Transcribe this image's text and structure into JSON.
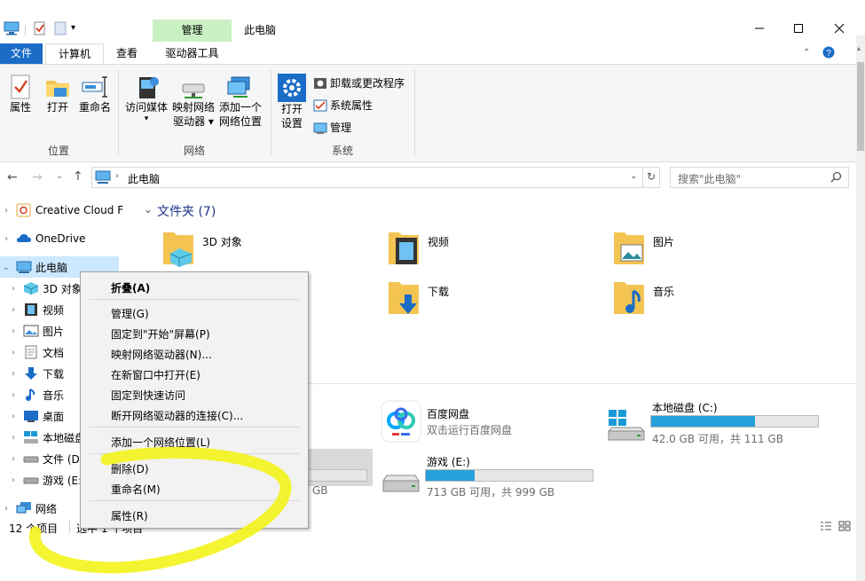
{
  "window": {
    "title": "此电脑",
    "context_tab_group": "管理"
  },
  "ribbon_tabs": [
    "文件",
    "计算机",
    "查看",
    "驱动器工具"
  ],
  "ribbon": {
    "location": {
      "label": "位置",
      "buttons": [
        "属性",
        "打开",
        "重命名"
      ]
    },
    "network": {
      "label": "网络",
      "buttons": [
        [
          "访问媒体",
          ""
        ],
        [
          "映射网络",
          "驱动器"
        ],
        [
          "添加一个",
          "网络位置"
        ]
      ]
    },
    "system": {
      "label": "系统",
      "open_settings": [
        "打开",
        "设置"
      ],
      "small_items": [
        "卸载或更改程序",
        "系统属性",
        "管理"
      ]
    }
  },
  "address": {
    "path": "此电脑",
    "search_placeholder": "搜索\"此电脑\""
  },
  "nav": {
    "items": [
      {
        "label": "Creative Cloud F",
        "icon": "creative-cloud-icon"
      },
      {
        "label": "OneDrive",
        "icon": "onedrive-icon"
      },
      {
        "label": "此电脑",
        "icon": "computer-icon"
      },
      {
        "label": "3D 对象",
        "icon": "3d-objects-icon"
      },
      {
        "label": "视频",
        "icon": "video-icon"
      },
      {
        "label": "图片",
        "icon": "pictures-icon"
      },
      {
        "label": "文档",
        "icon": "documents-icon"
      },
      {
        "label": "下载",
        "icon": "downloads-icon"
      },
      {
        "label": "音乐",
        "icon": "music-icon"
      },
      {
        "label": "桌面",
        "icon": "desktop-icon"
      },
      {
        "label": "本地磁盘",
        "icon": "local-disk-icon"
      },
      {
        "label": "文件 (D",
        "icon": "drive-icon"
      },
      {
        "label": "游戏 (E:",
        "icon": "drive-icon"
      },
      {
        "label": "网络",
        "icon": "network-icon"
      }
    ]
  },
  "content": {
    "folders_header": "文件夹 (7)",
    "folders": [
      "3D 对象",
      "视频",
      "图片",
      "下载",
      "音乐"
    ],
    "devices": {
      "baidu": {
        "name": "百度网盘",
        "sub": "双击运行百度网盘"
      },
      "c": {
        "name": "本地磁盘 (C:)",
        "sub": "42.0 GB 可用，共 111 GB",
        "used_fraction": 0.62
      },
      "e": {
        "name": "游戏 (E:)",
        "sub": "713 GB 可用，共 999 GB",
        "used_fraction": 0.29
      },
      "d_partial": "GB"
    }
  },
  "status": {
    "count": "12 个项目",
    "selection": "选中 1 个项目"
  },
  "context_menu": {
    "items": [
      "折叠(A)",
      "管理(G)",
      "固定到\"开始\"屏幕(P)",
      "映射网络驱动器(N)...",
      "在新窗口中打开(E)",
      "固定到快速访问",
      "断开网络驱动器的连接(C)...",
      "添加一个网络位置(L)",
      "删除(D)",
      "重命名(M)",
      "属性(R)"
    ]
  },
  "colors": {
    "accent": "#1a6cc6",
    "context_tab": "#c9f0c2",
    "drive_bar": "#26a0da",
    "annotation": "#f3f31a"
  }
}
